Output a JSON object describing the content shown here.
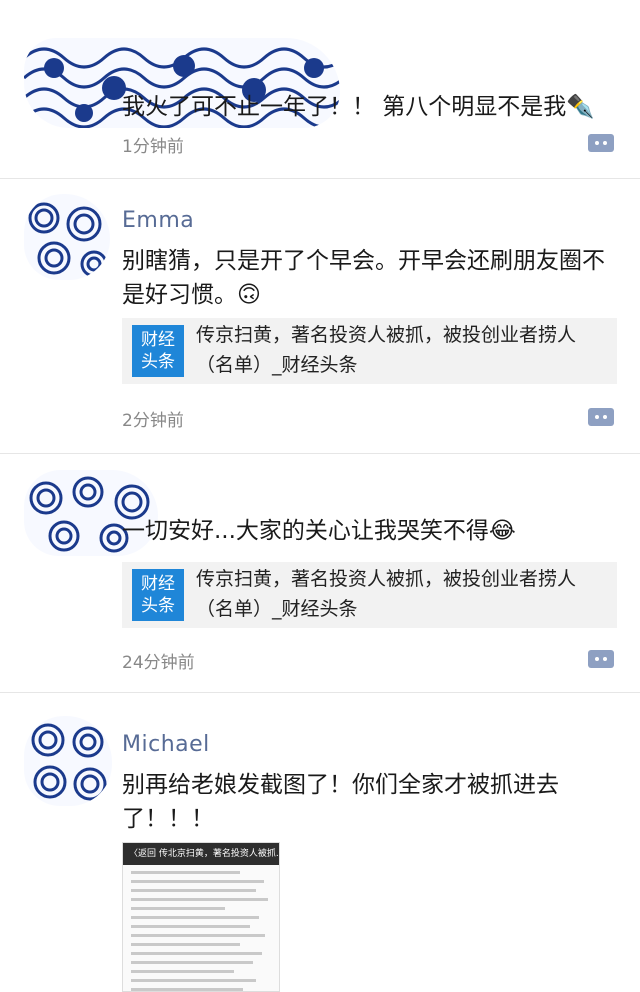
{
  "posts": [
    {
      "name": "",
      "text": "我火了可不止一年了！！ 第八个明显不是我✒️",
      "time": "1分钟前"
    },
    {
      "name": "Emma",
      "text": "别瞎猜，只是开了个早会。开早会还刷朋友圈不是好习惯。🙃",
      "link": {
        "thumb_line1": "财经",
        "thumb_line2": "头条",
        "title": "传京扫黄，著名投资人被抓，被投创业者捞人（名单）_财经头条"
      },
      "time": "2分钟前"
    },
    {
      "name": "",
      "text": "一切安好...大家的关心让我哭笑不得😂",
      "link": {
        "thumb_line1": "财经",
        "thumb_line2": "头条",
        "title": "传京扫黄，著名投资人被抓，被投创业者捞人（名单）_财经头条"
      },
      "time": "24分钟前"
    },
    {
      "name": "Michael",
      "text": "别再给老娘发截图了！你们全家才被抓进去了！！！",
      "screenshot": {
        "bar_text": "〈返回  传北京扫黄，著名投资人被抓..."
      }
    }
  ],
  "colors": {
    "name": "#576b95",
    "more_button": "#8ea0c2",
    "link_thumb": "#1f86d8",
    "avatar_wave": "#1b3a8c"
  }
}
